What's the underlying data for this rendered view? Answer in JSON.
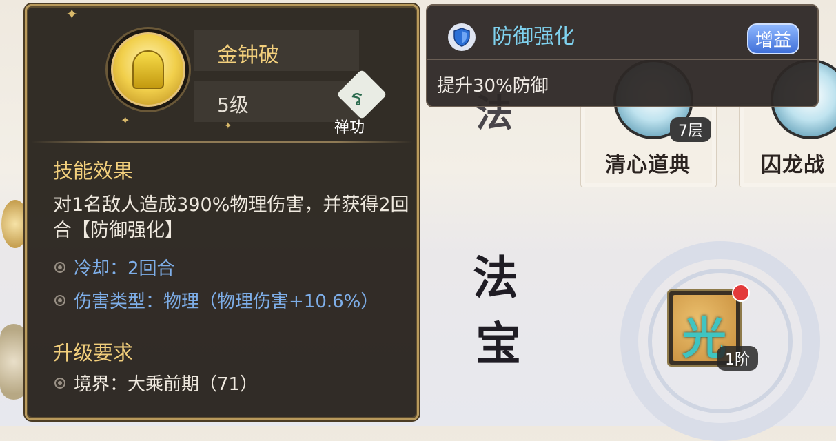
{
  "background": {
    "skills": [
      {
        "name": "清心道典",
        "layers": "7层"
      },
      {
        "name": "囚龙战",
        "layers": ""
      }
    ],
    "calligraphy_top": "法",
    "calligraphy_side": [
      "法",
      "宝"
    ],
    "fabao": {
      "glyph": "光",
      "rank": "1阶"
    }
  },
  "buff_tooltip": {
    "title": "防御强化",
    "tag": "增益",
    "description": "提升30%防御"
  },
  "skill_tooltip": {
    "name": "金钟破",
    "level": "5级",
    "category": "禅功",
    "category_glyph": "ร",
    "effect_title": "技能效果",
    "effect_text": "对1名敌人造成390%物理伤害，并获得2回合【防御强化】",
    "cooldown": "冷却：2回合",
    "damage_type": "伤害类型：物理（物理伤害+10.6%）",
    "upgrade_title": "升级要求",
    "upgrade_requirement": "境界：大乘前期（71）"
  },
  "colors": {
    "accent_gold": "#f2cf7c",
    "buff_blue": "#7fd1ee",
    "stat_blue": "#7eaee8"
  }
}
